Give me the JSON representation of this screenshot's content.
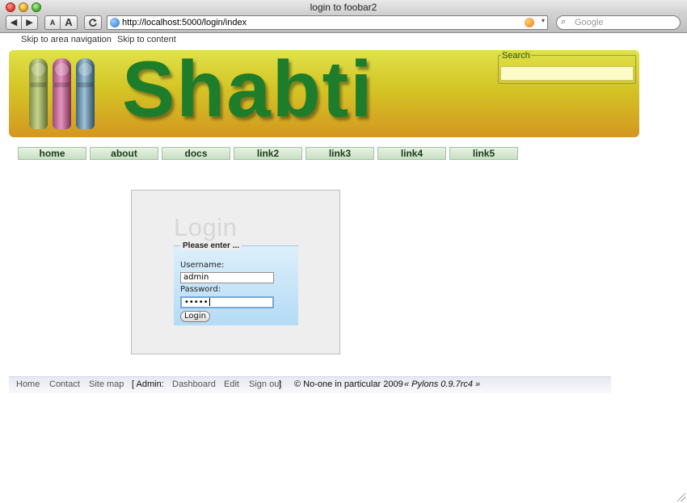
{
  "window": {
    "title": "login to foobar2"
  },
  "toolbar": {
    "back_glyph": "◀",
    "forward_glyph": "▶",
    "smaller_text": "A",
    "bigger_text": "A",
    "reload_glyph": "C",
    "url": "http://localhost:5000/login/index",
    "search_placeholder": "Google"
  },
  "skip_links": {
    "area_navigation": "Skip to area navigation",
    "content": "Skip to content"
  },
  "banner": {
    "title": "Shabti",
    "search_legend": "Search",
    "search_value": ""
  },
  "nav": [
    "home",
    "about",
    "docs",
    "link2",
    "link3",
    "link4",
    "link5"
  ],
  "login": {
    "heading": "Login",
    "legend": "Please enter ...",
    "username_label": "Username:",
    "username_value": "admin",
    "password_label": "Password:",
    "password_mask": "•••••",
    "button_label": "Login"
  },
  "footer": {
    "home": "Home",
    "contact": "Contact",
    "sitemap": "Site map",
    "admin_label": "[ Admin:",
    "dashboard": "Dashboard",
    "edit": "Edit",
    "signout": "Sign out",
    "close_bracket": "]",
    "copyright": "© No-one in particular 2009",
    "pylons": "« Pylons 0.9.7rc4 »"
  },
  "colors": {
    "banner_top": "#dfe24a",
    "banner_bottom": "#d49720",
    "title_green": "#1e7d2a",
    "nav_bg": "#d6e8d0",
    "login_panel": "#eeeeee",
    "login_fieldset": "#b4dbf5"
  }
}
